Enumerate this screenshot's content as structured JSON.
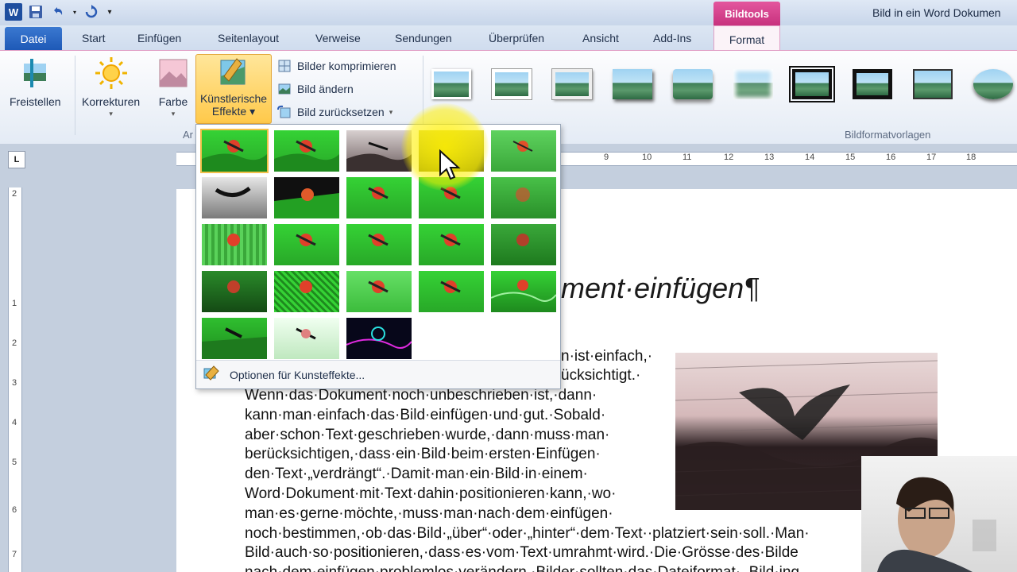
{
  "window": {
    "title": "Bild in ein Word Dokumen",
    "context_tab": "Bildtools"
  },
  "tabs": [
    "Datei",
    "Start",
    "Einfügen",
    "Seitenlayout",
    "Verweise",
    "Sendungen",
    "Überprüfen",
    "Ansicht",
    "Add-Ins",
    "Format"
  ],
  "ribbon": {
    "freistellen": "Freistellen",
    "korrekturen": "Korrekturen",
    "farbe": "Farbe",
    "kuenstlerische_line1": "Künstlerische",
    "kuenstlerische_line2": "Effekte",
    "bilder_komprimieren": "Bilder komprimieren",
    "bild_aendern": "Bild ändern",
    "bild_zuruecksetzen": "Bild zurücksetzen",
    "group_partial": "Ar",
    "group_bildformatvorlagen": "Bildformatvorlagen"
  },
  "ruler": [
    "9",
    "10",
    "11",
    "12",
    "13",
    "14",
    "15",
    "16",
    "17",
    "18"
  ],
  "vruler": [
    "2",
    "1",
    "2",
    "3",
    "4",
    "5",
    "6",
    "7"
  ],
  "ruler_corner": "L",
  "gallery": {
    "options_label": "Optionen für Kunsteffekte..."
  },
  "document": {
    "heading_visible": "ment·einfügen¶",
    "partial_line1": "n·ist·einfach,·",
    "partial_line2": "ücksichtigt.·",
    "lines": [
      "Wenn·das·Dokument·noch·unbeschrieben·ist,·dann·",
      "kann·man·einfach·das·Bild·einfügen·und·gut.·Sobald·",
      "aber·schon·Text·geschrieben·wurde,·dann·muss·man·",
      "berücksichtigen,·dass·ein·Bild·beim·ersten·Einfügen·",
      "den·Text·„verdrängt“.·Damit·man·ein·Bild·in·einem·",
      "Word·Dokument·mit·Text·dahin·positionieren·kann,·wo·",
      "man·es·gerne·möchte,·muss·man·nach·dem·einfügen·",
      "noch·bestimmen,·ob·das·Bild·„über“·oder·„hinter“·dem·Text··platziert·sein·soll.·Man·",
      "Bild·auch·so·positionieren,·dass·es·vom·Text·umrahmt·wird.·Die·Grösse·des·Bilde",
      "nach·dem·einfügen·problemlos·verändern.·Bilder·sollten·das·Dateiformat·..Bild·ing"
    ]
  },
  "colors": {
    "accent_pink": "#c8327e",
    "datei_blue": "#1d58b6",
    "selected_gold": "#ffc94a",
    "thumb_green": "#2fbf2f"
  }
}
